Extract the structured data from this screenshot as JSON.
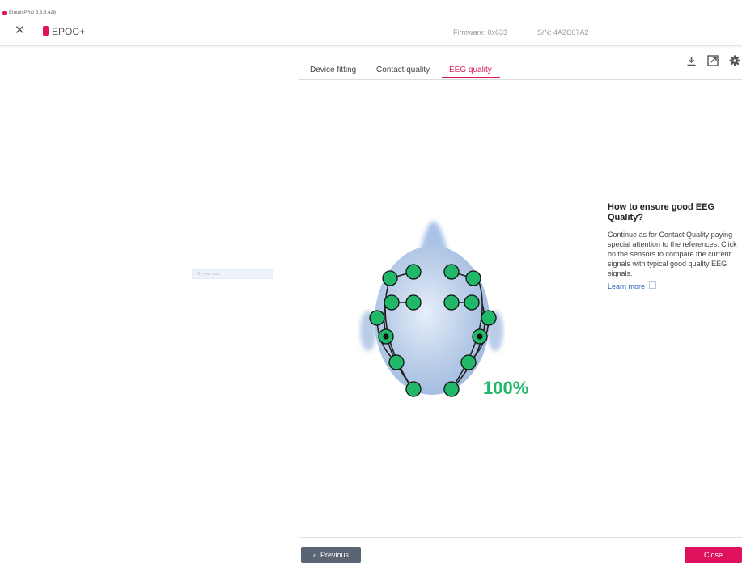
{
  "app": {
    "title": "EmotivPRO 3.3.5.428"
  },
  "header": {
    "device_name": "EPOC+",
    "firmware": "Firmware: 0x633",
    "serial": "S/N: 4A2C07A2"
  },
  "tabs": [
    {
      "label": "Device fitting",
      "active": false
    },
    {
      "label": "Contact quality",
      "active": false
    },
    {
      "label": "EEG quality",
      "active": true
    }
  ],
  "toolbar": {
    "icons": [
      "download-icon",
      "external-link-icon",
      "gear-icon"
    ]
  },
  "left_panel": {
    "hint_text": "My new card"
  },
  "quality": {
    "percent_text": "100%",
    "percent": 100,
    "sensor_color": "#22b86a",
    "accent": "#d81b60"
  },
  "info": {
    "title": "How to ensure good EEG Quality?",
    "body": "Continue as for Contact Quality paying special attention to the references. Click on the sensors to compare the current signals with typical good quality EEG signals.",
    "link": "Learn more"
  },
  "footer": {
    "previous_label": "Previous",
    "close_label": "Close",
    "close_color": "#e0125e"
  }
}
